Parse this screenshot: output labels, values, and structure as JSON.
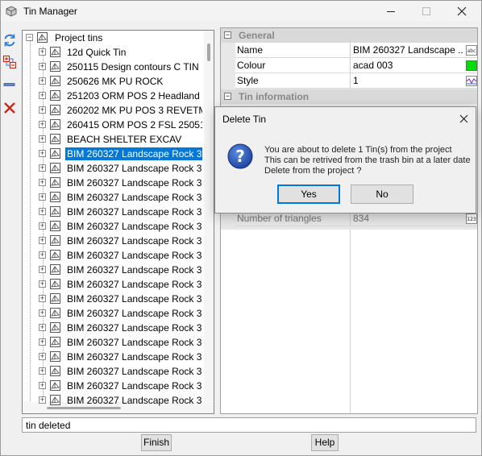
{
  "window": {
    "title": "Tin Manager"
  },
  "tree": {
    "root_label": "Project tins",
    "items": [
      "12d Quick Tin",
      "250115 Design contours C TIN",
      "250626 MK PU ROCK",
      "251203 ORM   POS 2 Headland",
      "260202 MK PU POS 3 REVETMI",
      "260415 ORM   POS 2 FSL 25051",
      "BEACH SHELTER EXCAV",
      "BIM 260327 Landscape Rock 3",
      "BIM 260327 Landscape Rock 3",
      "BIM 260327 Landscape Rock 3",
      "BIM 260327 Landscape Rock 3",
      "BIM 260327 Landscape Rock 3",
      "BIM 260327 Landscape Rock 3",
      "BIM 260327 Landscape Rock 3",
      "BIM 260327 Landscape Rock 3",
      "BIM 260327 Landscape Rock 3",
      "BIM 260327 Landscape Rock 3",
      "BIM 260327 Landscape Rock 3",
      "BIM 260327 Landscape Rock 3",
      "BIM 260327 Landscape Rock 3",
      "BIM 260327 Landscape Rock 3",
      "BIM 260327 Landscape Rock 3",
      "BIM 260327 Landscape Rock 3",
      "BIM 260327 Landscape Rock 3",
      "BIM 260327 Landscape Rock 3"
    ],
    "selected_index": 7
  },
  "properties": {
    "general_header": "General",
    "rows": [
      {
        "name": "Name",
        "value": "BIM 260327 Landscape ...",
        "icon": "text-abc-icon"
      },
      {
        "name": "Colour",
        "value": "acad 003",
        "swatch": "#00dd00"
      },
      {
        "name": "Style",
        "value": "1",
        "icon": "line-style-icon"
      }
    ],
    "tin_info_header": "Tin information",
    "triangles": {
      "name": "Number of triangles",
      "value": "834",
      "icon": "number-123-icon"
    }
  },
  "status": {
    "text": "tin deleted"
  },
  "buttons": {
    "finish": "Finish",
    "help": "Help"
  },
  "dialog": {
    "title": "Delete Tin",
    "line1": "You are about to delete 1 Tin(s) from the project",
    "line2": "This can be retrived from the trash bin at a later date",
    "line3": "Delete from the project ?",
    "yes": "Yes",
    "no": "No"
  },
  "colors": {
    "selection": "#0078d7",
    "accent_red": "#c42b1c",
    "refresh_blue": "#2b7bd6"
  }
}
